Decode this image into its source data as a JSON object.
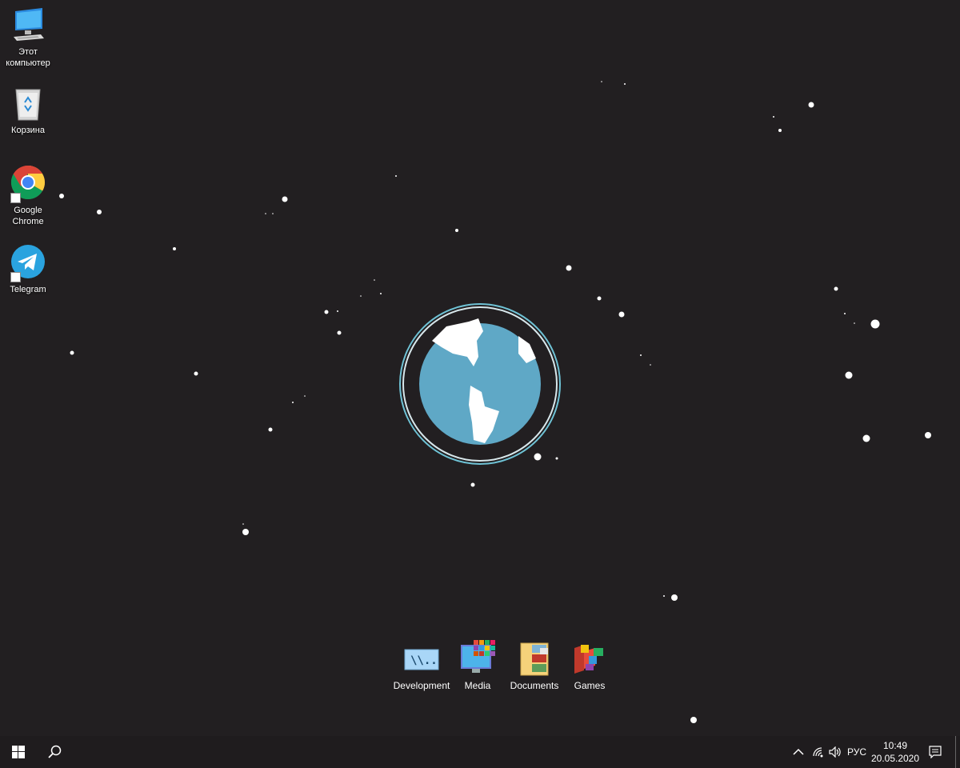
{
  "desktop": {
    "icons": [
      {
        "label": "Этот компьютер",
        "icon": "this-pc-icon"
      },
      {
        "label": "Корзина",
        "icon": "recycle-bin-icon"
      },
      {
        "label": "Google Chrome",
        "icon": "chrome-icon"
      },
      {
        "label": "Telegram",
        "icon": "telegram-icon"
      }
    ],
    "center_widget": {
      "icon": "globe-icon"
    },
    "dock": [
      {
        "label": "Development",
        "icon": "terminal-folder-icon"
      },
      {
        "label": "Media",
        "icon": "media-folder-icon"
      },
      {
        "label": "Documents",
        "icon": "documents-folder-icon"
      },
      {
        "label": "Games",
        "icon": "games-folder-icon"
      }
    ]
  },
  "taskbar": {
    "start": "windows-start-icon",
    "search": "search-icon",
    "tray": {
      "chevron": "chevron-up-icon",
      "network": "wifi-icon",
      "volume": "speaker-icon",
      "language": "РУС",
      "time": "10:49",
      "date": "20.05.2020",
      "notifications": "action-center-icon"
    }
  },
  "colors": {
    "background": "#221f21",
    "globe_ocean": "#5fa8c6",
    "globe_ring": "#6fc3d6",
    "taskbar": "#1f1c1e"
  }
}
